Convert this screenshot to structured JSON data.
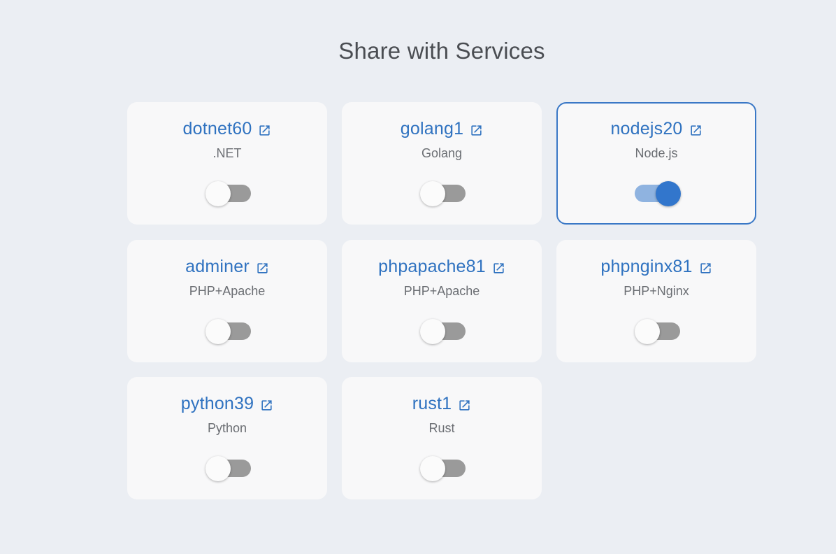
{
  "page": {
    "title": "Share with Services"
  },
  "colors": {
    "background": "#ebeef3",
    "card_background": "#f8f8f9",
    "accent": "#2f72c0",
    "toggle_on": "#3276cc",
    "toggle_off_track": "#9a9a9a",
    "selected_border": "#3a78c6"
  },
  "services": [
    {
      "name": "dotnet60",
      "type": ".NET",
      "enabled": false,
      "icon": "external-link-icon"
    },
    {
      "name": "golang1",
      "type": "Golang",
      "enabled": false,
      "icon": "external-link-icon"
    },
    {
      "name": "nodejs20",
      "type": "Node.js",
      "enabled": true,
      "icon": "external-link-icon"
    },
    {
      "name": "adminer",
      "type": "PHP+Apache",
      "enabled": false,
      "icon": "external-link-icon"
    },
    {
      "name": "phpapache81",
      "type": "PHP+Apache",
      "enabled": false,
      "icon": "external-link-icon"
    },
    {
      "name": "phpnginx81",
      "type": "PHP+Nginx",
      "enabled": false,
      "icon": "external-link-icon"
    },
    {
      "name": "python39",
      "type": "Python",
      "enabled": false,
      "icon": "external-link-icon"
    },
    {
      "name": "rust1",
      "type": "Rust",
      "enabled": false,
      "icon": "external-link-icon"
    }
  ]
}
